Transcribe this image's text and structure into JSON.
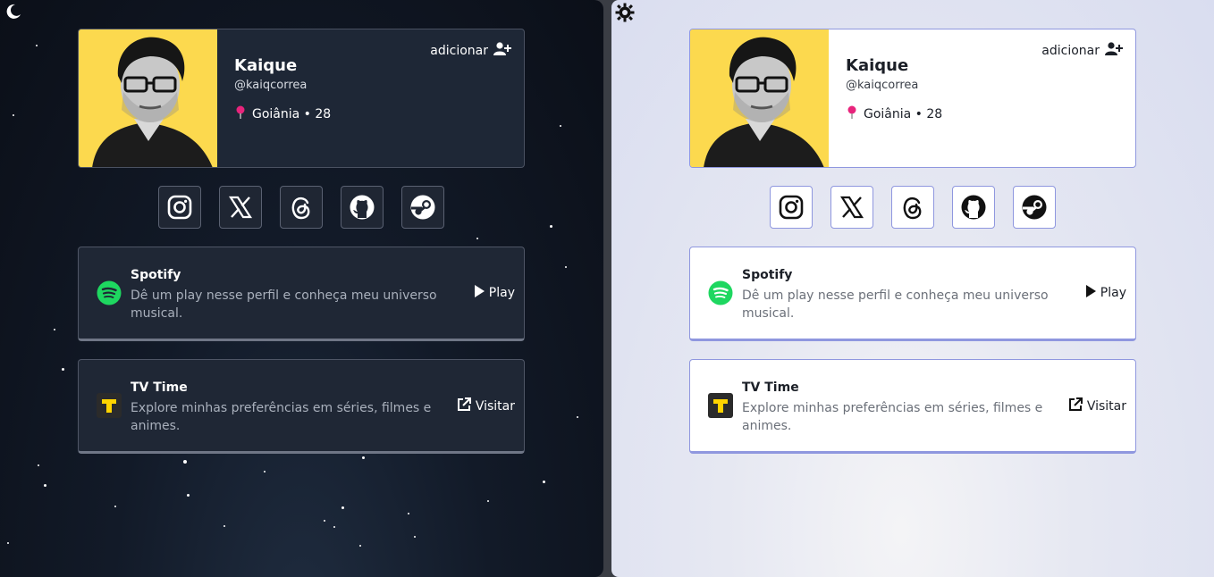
{
  "profile": {
    "name": "Kaique",
    "handle": "@kaiqcorrea",
    "location": "Goiânia • 28",
    "add_label": "adicionar"
  },
  "socials": [
    {
      "icon": "instagram-icon"
    },
    {
      "icon": "x-icon"
    },
    {
      "icon": "threads-icon"
    },
    {
      "icon": "github-icon"
    },
    {
      "icon": "steam-icon"
    }
  ],
  "links": [
    {
      "title": "Spotify",
      "description": "Dê um play nesse perfil e conheça meu universo musical.",
      "action": "Play",
      "icon": "spotify-icon"
    },
    {
      "title": "TV Time",
      "description": "Explore minhas preferências em séries, filmes e animes.",
      "action": "Visitar",
      "icon": "tvtime-icon"
    }
  ],
  "colors": {
    "avatar_bg": "#fcd94e",
    "spotify": "#1ed760",
    "tvtime": "#ffd400",
    "location_pin": "#e8247c",
    "light_accent": "#8f97df"
  },
  "theme_icons": {
    "dark": "moon-icon",
    "light": "sun-gear-icon"
  }
}
